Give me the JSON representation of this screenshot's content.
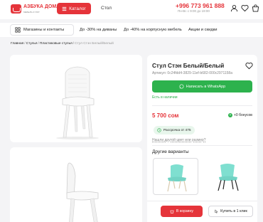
{
  "header": {
    "logo_name": "АЗБУКА ДОМА",
    "logo_sub": "МЕБЕЛЬ И УЮТ",
    "catalog_label": "Каталог",
    "search_value": "Стол",
    "phone": "+996 773 961 888",
    "hours": "Пн-Вс с 9:00 до 19:00",
    "icons": [
      "user-icon",
      "heart-icon",
      "cart-icon"
    ]
  },
  "nav": {
    "items": [
      "Магазины и контакты",
      "До -30% на диваны",
      "До -40% на корпусную мебель",
      "Акции и скидки"
    ]
  },
  "breadcrumbs": [
    "Главная",
    "Стулья",
    "Пластиковые стулья",
    "Стул Стэн Белый/Белый"
  ],
  "product": {
    "title": "Стул Стэн Белый/Белый",
    "article": "Артикул: 0c24fdd4-3829-11ef-b682-000c2971158a",
    "whatsapp_label": "Написать в WhatsApp",
    "stock": "Есть в наличии",
    "price": "5 700 сом",
    "bonus": "+0 бонусов",
    "installment": "Рассрочка от 475",
    "other_color": "Нашли другой цвет или размер?",
    "variants_title": "Другие варианты",
    "variants": [
      {
        "name": "variant-mint-chair",
        "color": "#7fdfd0"
      },
      {
        "name": "variant-mint-chair-black-legs",
        "color": "#7fdfd0"
      }
    ]
  },
  "buy": {
    "cart_label": "В корзину",
    "oneclick_label": "Купить в 1 клик"
  },
  "colors": {
    "brand_red": "#e5343a",
    "whatsapp_green": "#2db24d",
    "page_bg": "#f4f4f6"
  }
}
